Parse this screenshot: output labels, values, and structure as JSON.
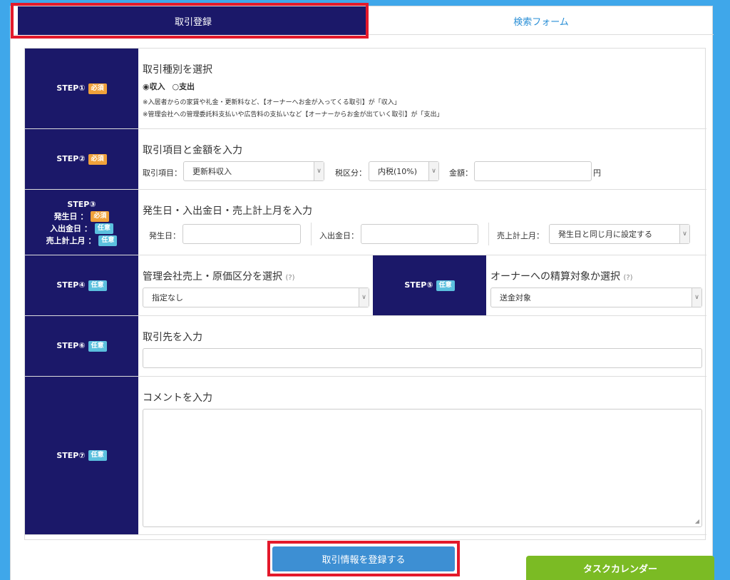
{
  "tabs": {
    "active": "取引登録",
    "inactive": "検索フォーム"
  },
  "badges": {
    "required": "必須",
    "optional": "任意"
  },
  "step1": {
    "label": "STEP①",
    "title": "取引種別を選択",
    "radio_income": "収入",
    "radio_expense": "支出",
    "note1": "※入居者からの家賃や礼金・更新料など、【オーナーへお金が入ってくる取引】が「収入」",
    "note2": "※管理会社への管理委託料支払いや広告料の支払いなど【オーナーからお金が出ていく取引】が「支出」"
  },
  "step2": {
    "label": "STEP②",
    "title": "取引項目と金額を入力",
    "item_label": "取引項目：",
    "item_value": "更新料収入",
    "tax_label": "税区分：",
    "tax_value": "内税(10%)",
    "amount_label": "金額：",
    "amount_value": "",
    "unit": "円"
  },
  "step3": {
    "label": "STEP③",
    "sub1": "発生日 ：",
    "sub2": "入出金日 ：",
    "sub3": "売上計上月 ：",
    "title": "発生日・入出金日・売上計上月を入力",
    "date_label": "発生日：",
    "date_value": "",
    "payment_label": "入出金日：",
    "payment_value": "",
    "month_label": "売上計上月：",
    "month_value": "発生日と同じ月に設定する"
  },
  "step4": {
    "label": "STEP④",
    "title": "管理会社売上・原価区分を選択",
    "help": "(?)",
    "value": "指定なし"
  },
  "step5": {
    "label": "STEP⑤",
    "title": "オーナーへの精算対象か選択",
    "help": "(?)",
    "value": "送金対象"
  },
  "step6": {
    "label": "STEP⑥",
    "title": "取引先を入力",
    "value": ""
  },
  "step7": {
    "label": "STEP⑦",
    "title": "コメントを入力",
    "value": ""
  },
  "submit_label": "取引情報を登録する",
  "task_calendar_label": "タスクカレンダー",
  "colors": {
    "navy": "#1b1869",
    "highlight": "#e3192b",
    "submit": "#3d8fd3",
    "task": "#7bbb24",
    "required": "#f0a13a",
    "optional": "#5bc0de"
  }
}
